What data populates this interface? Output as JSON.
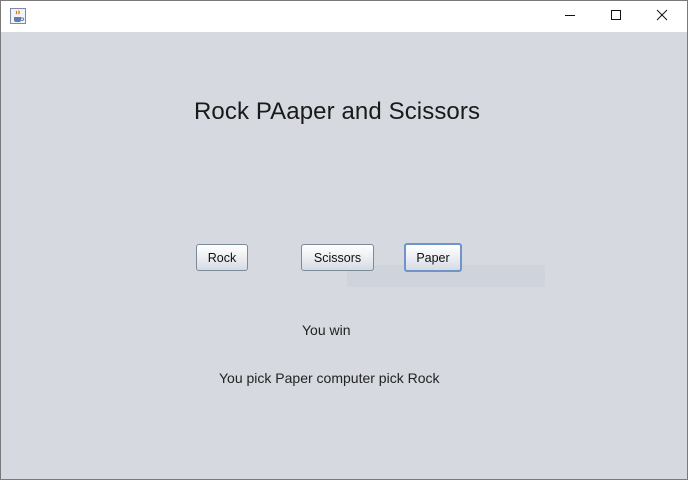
{
  "window": {
    "icon": "java-cup-icon",
    "controls": {
      "minimize": "minimize-icon",
      "maximize": "maximize-icon",
      "close": "close-icon"
    }
  },
  "game": {
    "title": "Rock PAaper and Scissors",
    "buttons": {
      "rock": "Rock",
      "scissors": "Scissors",
      "paper": "Paper"
    },
    "focused_button": "paper",
    "result": "You win",
    "detail": "You pick Paper computer pick Rock"
  },
  "colors": {
    "panel_background": "#d6d9e0",
    "titlebar_background": "#ffffff",
    "focus_border": "#6f94c9"
  }
}
